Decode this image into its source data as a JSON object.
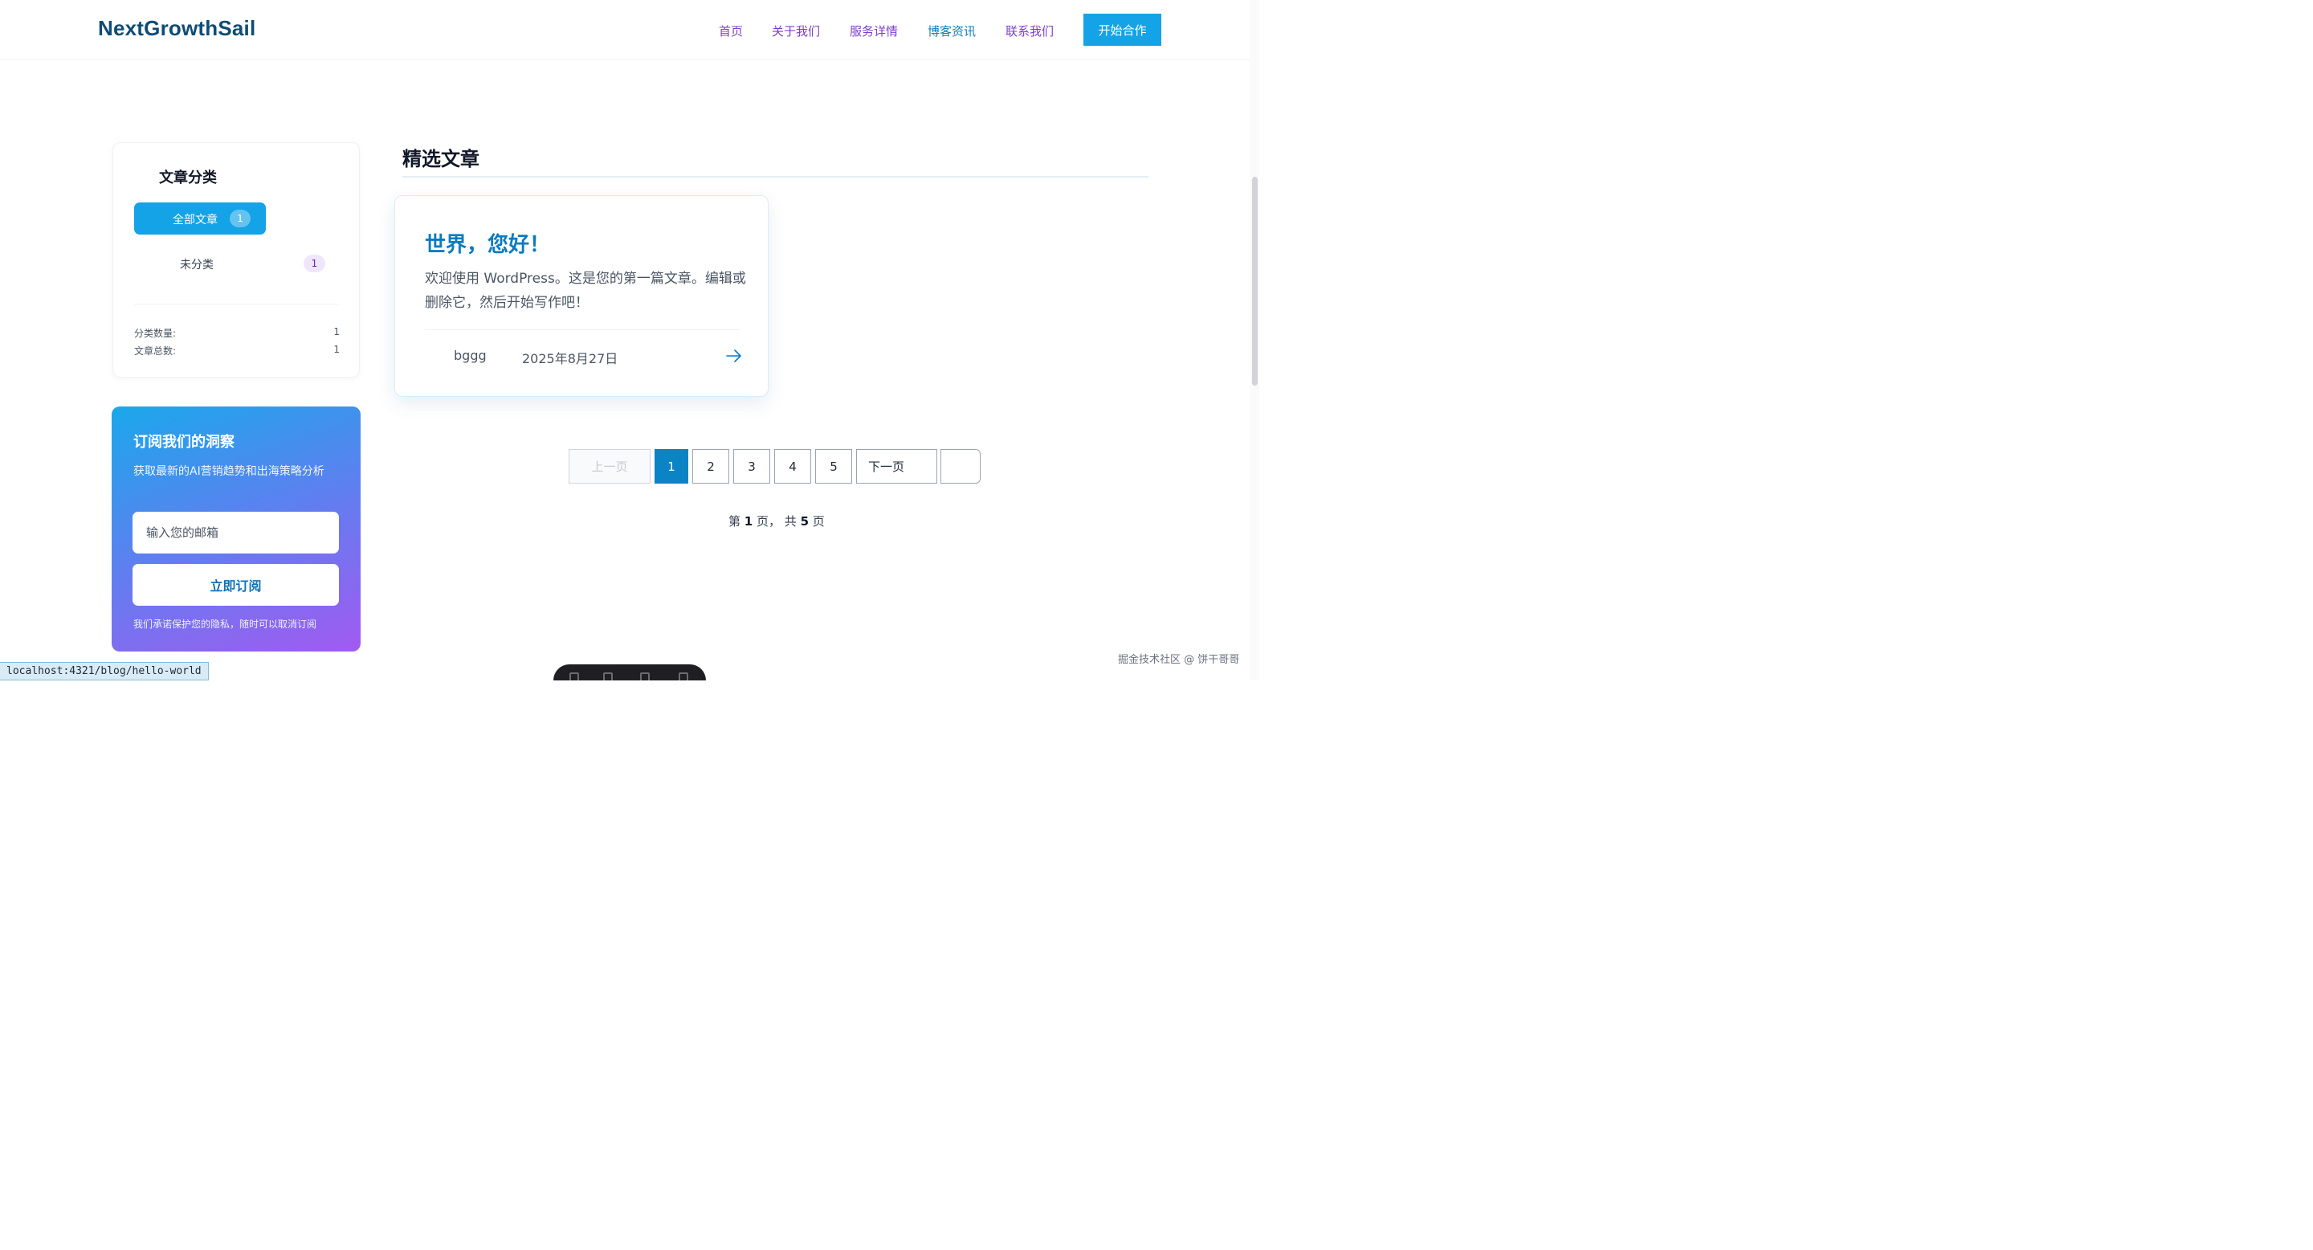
{
  "header": {
    "logo": "NextGrowthSail",
    "nav": [
      "首页",
      "关于我们",
      "服务详情",
      "博客资讯",
      "联系我们"
    ],
    "cta": "开始合作"
  },
  "sidebar": {
    "categories_title": "文章分类",
    "categories": [
      {
        "label": "全部文章",
        "count": "1",
        "active": true
      },
      {
        "label": "未分类",
        "count": "1",
        "active": false
      }
    ],
    "stats": [
      {
        "label": "分类数量:",
        "value": "1"
      },
      {
        "label": "文章总数:",
        "value": "1"
      }
    ]
  },
  "subscribe": {
    "title": "订阅我们的洞察",
    "description": "获取最新的AI营销趋势和出海策略分析",
    "email_placeholder": "输入您的邮箱",
    "button": "立即订阅",
    "note": "我们承诺保护您的隐私，随时可以取消订阅"
  },
  "main": {
    "section_title": "精选文章",
    "post": {
      "title": "世界，您好！",
      "excerpt": "欢迎使用 WordPress。这是您的第一篇文章。编辑或删除它，然后开始写作吧！",
      "author": "bggg",
      "date": "2025年8月27日",
      "arrow_icon": "arrow-right-icon"
    }
  },
  "pagination": {
    "prev": "上一页",
    "pages": [
      "1",
      "2",
      "3",
      "4",
      "5"
    ],
    "current": "1",
    "next": "下一页",
    "last": "",
    "info_prefix": "第",
    "info_current": "1",
    "info_mid": "页，  共",
    "info_total": "5",
    "info_suffix": "页"
  },
  "browser": {
    "status_url": "localhost:4321/blog/hello-world",
    "watermark": "掘金技术社区 @ 饼干哥哥"
  },
  "colors": {
    "accent": "#13a3e6",
    "nav_link": "#7e3fc9",
    "post_title": "#0b7bc0",
    "logo": "#0f4c75"
  }
}
